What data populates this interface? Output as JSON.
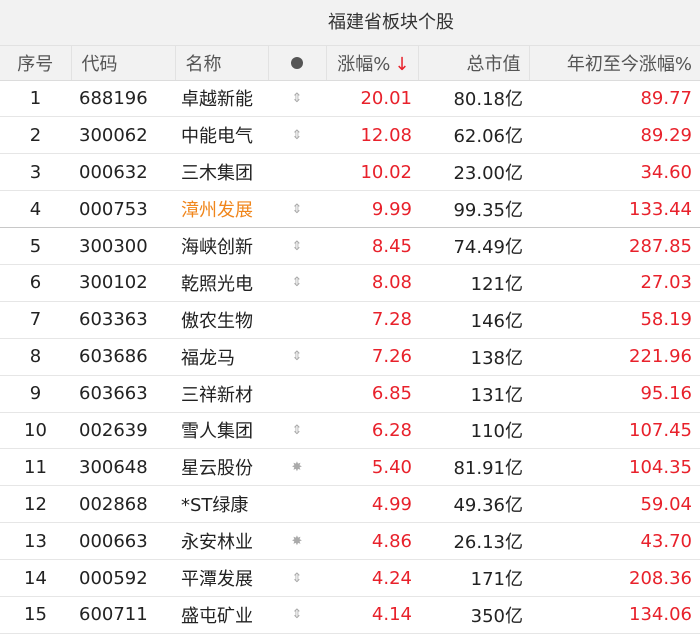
{
  "title": "福建省板块个股",
  "colors": {
    "up": "#e8212b",
    "highlight": "#f0861c",
    "header_bg": "#f2f2f2"
  },
  "headers": {
    "seq": "序号",
    "code": "代码",
    "name": "名称",
    "flag_icon": "dot-icon",
    "change": "涨幅%",
    "sort_icon": "↓",
    "market_cap": "总市值",
    "ytd": "年初至今涨幅%"
  },
  "rows": [
    {
      "seq": "1",
      "code": "688196",
      "name": "卓越新能",
      "flag": "⇕",
      "change": "20.01",
      "market_cap": "80.18亿",
      "ytd": "89.77"
    },
    {
      "seq": "2",
      "code": "300062",
      "name": "中能电气",
      "flag": "⇕",
      "change": "12.08",
      "market_cap": "62.06亿",
      "ytd": "89.29"
    },
    {
      "seq": "3",
      "code": "000632",
      "name": "三木集团",
      "flag": "",
      "change": "10.02",
      "market_cap": "23.00亿",
      "ytd": "34.60"
    },
    {
      "seq": "4",
      "code": "000753",
      "name": "漳州发展",
      "flag": "⇕",
      "change": "9.99",
      "market_cap": "99.35亿",
      "ytd": "133.44"
    },
    {
      "seq": "5",
      "code": "300300",
      "name": "海峡创新",
      "flag": "⇕",
      "change": "8.45",
      "market_cap": "74.49亿",
      "ytd": "287.85"
    },
    {
      "seq": "6",
      "code": "300102",
      "name": "乾照光电",
      "flag": "⇕",
      "change": "8.08",
      "market_cap": "121亿",
      "ytd": "27.03"
    },
    {
      "seq": "7",
      "code": "603363",
      "name": "傲农生物",
      "flag": "",
      "change": "7.28",
      "market_cap": "146亿",
      "ytd": "58.19"
    },
    {
      "seq": "8",
      "code": "603686",
      "name": "福龙马",
      "flag": "⇕",
      "change": "7.26",
      "market_cap": "138亿",
      "ytd": "221.96"
    },
    {
      "seq": "9",
      "code": "603663",
      "name": "三祥新材",
      "flag": "",
      "change": "6.85",
      "market_cap": "131亿",
      "ytd": "95.16"
    },
    {
      "seq": "10",
      "code": "002639",
      "name": "雪人集团",
      "flag": "⇕",
      "change": "6.28",
      "market_cap": "110亿",
      "ytd": "107.45"
    },
    {
      "seq": "11",
      "code": "300648",
      "name": "星云股份",
      "flag": "✸",
      "change": "5.40",
      "market_cap": "81.91亿",
      "ytd": "104.35"
    },
    {
      "seq": "12",
      "code": "002868",
      "name": "*ST绿康",
      "flag": "",
      "change": "4.99",
      "market_cap": "49.36亿",
      "ytd": "59.04"
    },
    {
      "seq": "13",
      "code": "000663",
      "name": "永安林业",
      "flag": "✸",
      "change": "4.86",
      "market_cap": "26.13亿",
      "ytd": "43.70"
    },
    {
      "seq": "14",
      "code": "000592",
      "name": "平潭发展",
      "flag": "⇕",
      "change": "4.24",
      "market_cap": "171亿",
      "ytd": "208.36"
    },
    {
      "seq": "15",
      "code": "600711",
      "name": "盛屯矿业",
      "flag": "⇕",
      "change": "4.14",
      "market_cap": "350亿",
      "ytd": "134.06"
    }
  ]
}
